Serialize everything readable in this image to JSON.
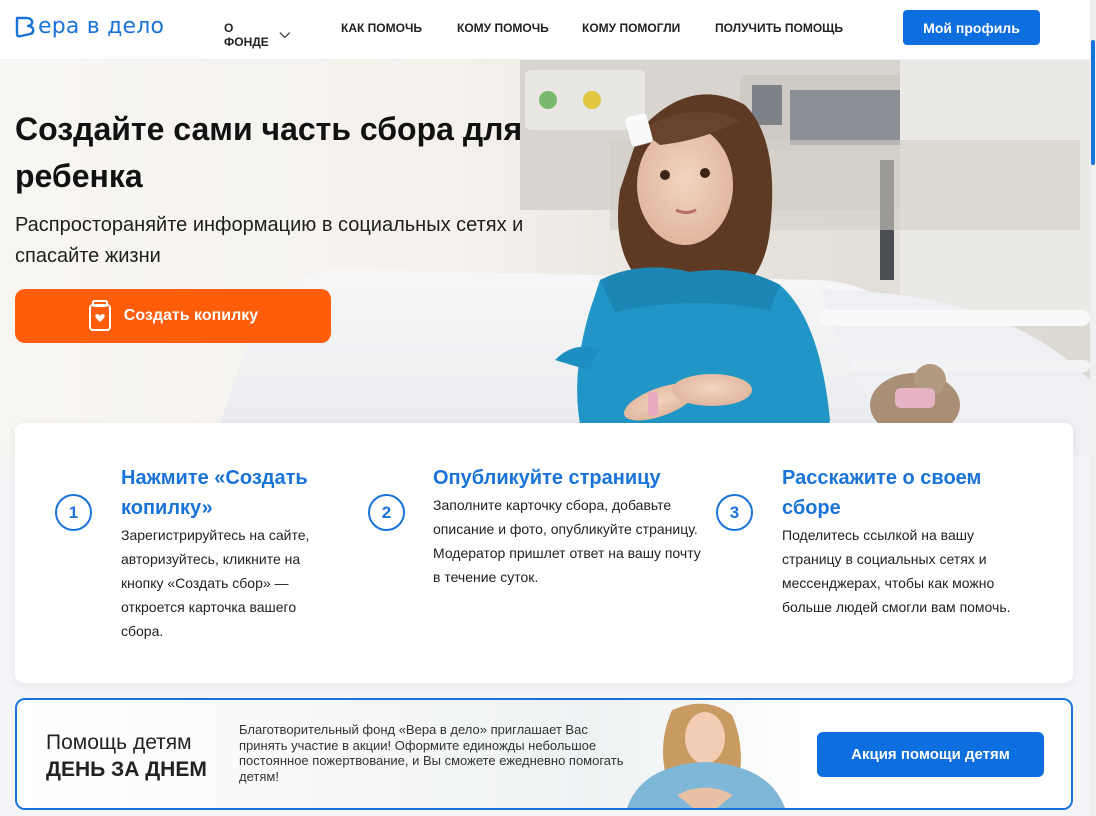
{
  "header": {
    "logo_text": "ера в дело",
    "nav": [
      {
        "label": "О ФОНДЕ"
      },
      {
        "label": "КАК ПОМОЧЬ"
      },
      {
        "label": "КОМУ ПОМОЧЬ"
      },
      {
        "label": "КОМУ ПОМОГЛИ"
      },
      {
        "label": "ПОЛУЧИТЬ ПОМОЩЬ"
      }
    ],
    "profile_button": "Мой профиль"
  },
  "hero": {
    "title": "Создайте сами часть сбора для ребенка",
    "subtitle": "Распростораняйте информацию в социальных сетях и спасайте жизни",
    "cta_label": "Создать копилку",
    "cta_icon": "piggy-jar-icon"
  },
  "steps": [
    {
      "number": "1",
      "title": "Нажмите «Создать копилку»",
      "text": "Зарегистрируйтесь на сайте, авторизуйтесь, кликните на кнопку «Создать сбор» — откроется карточка вашего сбора."
    },
    {
      "number": "2",
      "title": "Опубликуйте страницу",
      "text": "Заполните карточку сбора, добавьте описание и фото, опубликуйте страницу. Модератор пришлет ответ на вашу почту в течение суток."
    },
    {
      "number": "3",
      "title": "Расскажите о своем сборе",
      "text": "Поделитесь ссылкой на вашу страницу в социальных сетях и мессенджерах, чтобы как можно больше людей смогли вам помочь."
    }
  ],
  "banner": {
    "title_line1": "Помощь детям",
    "title_line2": "ДЕНЬ ЗА ДНЕМ",
    "text": "Благотворительный фонд «Вера в дело» приглашает Вас принять участие в акции! Оформите единожды небольшое постоянное пожертвование, и Вы сможете ежедневно помогать детям!",
    "button": "Акция помощи детям"
  },
  "colors": {
    "brand_blue": "#1a73d9",
    "cta_orange": "#ff5d0a"
  }
}
